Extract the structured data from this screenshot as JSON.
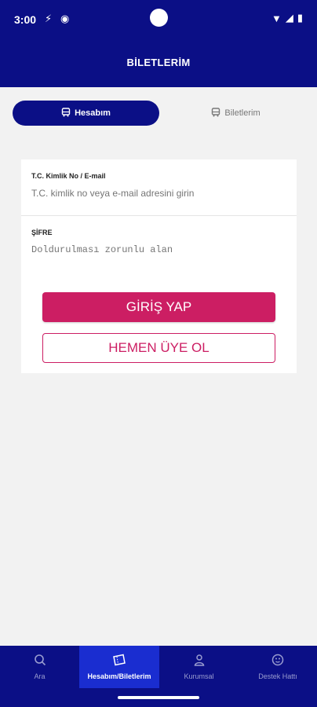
{
  "status_bar": {
    "time": "3:00"
  },
  "header": {
    "title": "BİLETLERİM"
  },
  "segment": {
    "active_label": "Hesabım",
    "inactive_label": "Biletlerim"
  },
  "form": {
    "id_label": "T.C. Kimlik No / E-mail",
    "id_placeholder": "T.C. kimlik no veya e-mail adresini girin",
    "password_label": "ŞİFRE",
    "password_placeholder": "Doldurulması zorunlu alan",
    "login_button": "GİRİŞ YAP",
    "register_button": "HEMEN ÜYE OL"
  },
  "bottom_nav": {
    "items": [
      {
        "label": "Ara",
        "icon": "search-icon"
      },
      {
        "label": "Hesabım/Biletlerim",
        "icon": "ticket-icon"
      },
      {
        "label": "Kurumsal",
        "icon": "person-icon"
      },
      {
        "label": "Destek Hattı",
        "icon": "support-icon"
      }
    ]
  },
  "colors": {
    "primary": "#0b0f86",
    "accent": "#cc1e63",
    "active_nav": "#1a2dd0"
  }
}
